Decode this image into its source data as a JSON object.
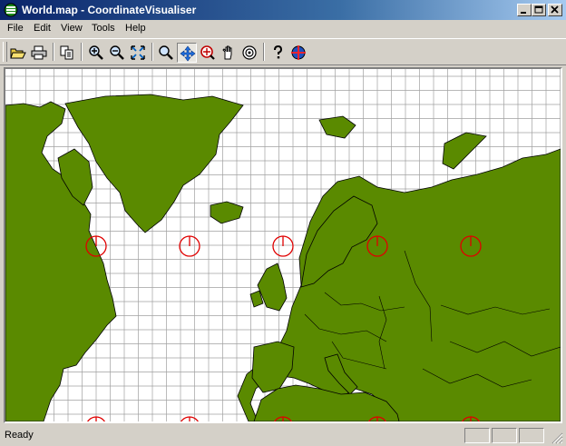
{
  "window": {
    "title": "World.map - CoordinateVisualiser",
    "app_icon": "globe-icon",
    "controls": [
      "minimize-icon",
      "maximize-icon",
      "close-icon"
    ]
  },
  "menu": [
    {
      "label": "File"
    },
    {
      "label": "Edit"
    },
    {
      "label": "View"
    },
    {
      "label": "Tools"
    },
    {
      "label": "Help"
    }
  ],
  "toolbar": {
    "buttons": [
      {
        "icon": "open-folder-icon",
        "pressed": false
      },
      {
        "icon": "print-icon",
        "pressed": false
      },
      {
        "icon": "copy-icon",
        "pressed": false
      },
      {
        "icon": "zoom-in-icon",
        "pressed": false
      },
      {
        "icon": "zoom-out-icon",
        "pressed": false
      },
      {
        "icon": "zoom-extents-icon",
        "pressed": false
      },
      {
        "icon": "magnify-icon",
        "pressed": false
      },
      {
        "icon": "pan-arrows-icon",
        "pressed": true
      },
      {
        "icon": "zoom-window-icon",
        "pressed": false
      },
      {
        "icon": "hand-icon",
        "pressed": false
      },
      {
        "icon": "target-icon",
        "pressed": false
      },
      {
        "icon": "help-icon",
        "pressed": false
      },
      {
        "icon": "crosshair-globe-icon",
        "pressed": false
      }
    ]
  },
  "map": {
    "land_color": "#5a8a00",
    "sea_color": "#ffffff",
    "grid_color": "#a0a0a0",
    "marker_color": "#e00000"
  },
  "status": {
    "text": "Ready"
  }
}
